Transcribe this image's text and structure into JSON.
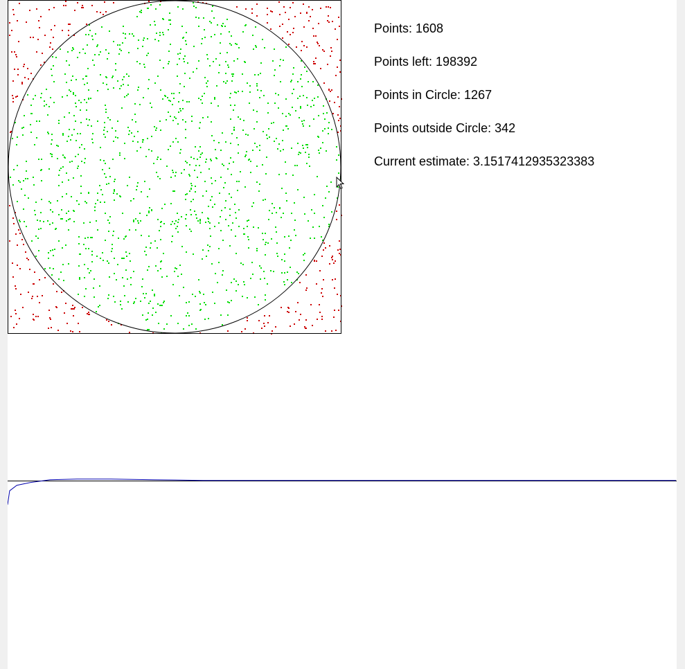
{
  "colors": {
    "window_bg": "#ffffff",
    "gutter": "#f0f0f0",
    "inside_point": "#00dd00",
    "outside_point": "#cc0000",
    "square_border": "#000000",
    "circle_stroke": "#000000",
    "reference_line": "#000000",
    "estimate_line": "#0000aa"
  },
  "stats": {
    "points": "Points: 1608",
    "points_left": "Points left: 198392",
    "points_in_circle": "Points in Circle: 1267",
    "points_outside_circle": "Points outside Circle: 342",
    "current_estimate": "Current estimate: 3.1517412935323383"
  },
  "simulation": {
    "total_points": 1608,
    "inside_points": 1267,
    "outside_points": 342,
    "estimate": 3.1517412935323383
  },
  "convergence": {
    "reference_value": 3.14159,
    "estimates": [
      2.8,
      3.0,
      3.08,
      3.12,
      3.16,
      3.17,
      3.17,
      3.16,
      3.15,
      3.15,
      3.15,
      3.15,
      3.15,
      3.15,
      3.15
    ]
  },
  "icons": {
    "cursor": "mouse-pointer-icon"
  }
}
